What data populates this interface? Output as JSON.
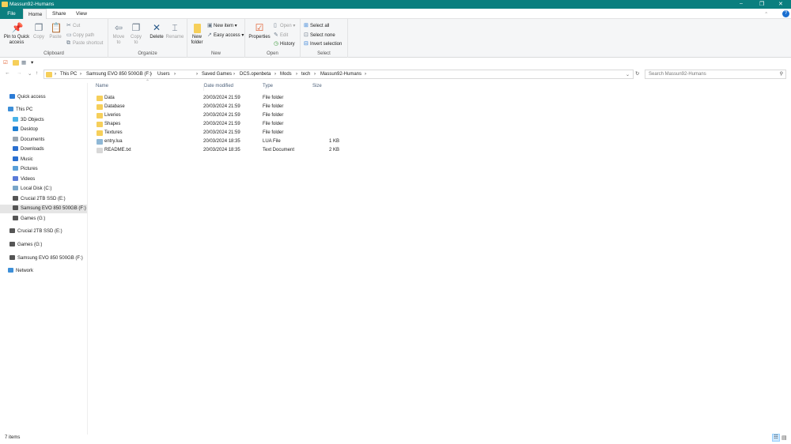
{
  "window": {
    "title": "Massun92-Humans",
    "minimize": "–",
    "maximize": "❐",
    "close": "✕"
  },
  "tabs": [
    "File",
    "Home",
    "Share",
    "View"
  ],
  "ribbon": {
    "clipboard": {
      "label": "Clipboard",
      "pin": "Pin to Quick access",
      "copy": "Copy",
      "paste": "Paste",
      "cut": "Cut",
      "copy_path": "Copy path",
      "paste_shortcut": "Paste shortcut"
    },
    "organize": {
      "label": "Organize",
      "move_to": "Move to",
      "copy_to": "Copy to",
      "delete": "Delete",
      "rename": "Rename"
    },
    "new": {
      "label": "New",
      "new_folder": "New folder",
      "new_item": "New item ▾",
      "easy_access": "Easy access ▾"
    },
    "open": {
      "label": "Open",
      "properties": "Properties",
      "open": "Open ▾",
      "edit": "Edit",
      "history": "History"
    },
    "select": {
      "label": "Select",
      "select_all": "Select all",
      "select_none": "Select none",
      "invert": "Invert selection"
    },
    "help": "?"
  },
  "address": {
    "crumbs": [
      "This PC",
      "Samsung EVO 850 500GB (F:)",
      "Users"
    ],
    "crumbs2": [
      "Saved Games",
      "DCS.openbeta",
      "Mods",
      "tech",
      "Massun92-Humans"
    ],
    "search_placeholder": "Search Massun92-Humans"
  },
  "nav": [
    {
      "label": "Quick access",
      "color": "#2b7bd6"
    },
    {
      "label": "This PC",
      "color": "#3d8fd8"
    },
    {
      "label": "3D Objects",
      "color": "#49b3e8"
    },
    {
      "label": "Desktop",
      "color": "#1e7fd3"
    },
    {
      "label": "Documents",
      "color": "#9aa7b3"
    },
    {
      "label": "Downloads",
      "color": "#2a6fd0"
    },
    {
      "label": "Music",
      "color": "#2a6fd0"
    },
    {
      "label": "Pictures",
      "color": "#5aa0d8"
    },
    {
      "label": "Videos",
      "color": "#5a7ad8"
    },
    {
      "label": "Local Disk (C:)",
      "color": "#7aa6c8"
    },
    {
      "label": "Crucial 2TB SSD (E:)",
      "color": "#555"
    },
    {
      "label": "Samsung EVO 850 500GB (F:)",
      "color": "#555"
    },
    {
      "label": "Games (G:)",
      "color": "#555"
    },
    {
      "label": "Crucial 2TB SSD (E:)",
      "color": "#555"
    },
    {
      "label": "Games (G:)",
      "color": "#555"
    },
    {
      "label": "Samsung EVO 850 500GB (F:)",
      "color": "#555"
    },
    {
      "label": "Network",
      "color": "#3d8fd8"
    }
  ],
  "columns": [
    "Name",
    "Date modified",
    "Type",
    "Size"
  ],
  "files": [
    {
      "name": "Data",
      "date": "20/03/2024 21:59",
      "type": "File folder",
      "size": "",
      "kind": "folder"
    },
    {
      "name": "Database",
      "date": "20/03/2024 21:59",
      "type": "File folder",
      "size": "",
      "kind": "folder"
    },
    {
      "name": "Liveries",
      "date": "20/03/2024 21:59",
      "type": "File folder",
      "size": "",
      "kind": "folder"
    },
    {
      "name": "Shapes",
      "date": "20/03/2024 21:59",
      "type": "File folder",
      "size": "",
      "kind": "folder"
    },
    {
      "name": "Textures",
      "date": "20/03/2024 21:59",
      "type": "File folder",
      "size": "",
      "kind": "folder"
    },
    {
      "name": "entry.lua",
      "date": "20/03/2024 18:35",
      "type": "LUA File",
      "size": "1 KB",
      "kind": "lua"
    },
    {
      "name": "README.txt",
      "date": "20/03/2024 18:35",
      "type": "Text Document",
      "size": "2 KB",
      "kind": "txt"
    }
  ],
  "status": {
    "items": "7 items"
  }
}
